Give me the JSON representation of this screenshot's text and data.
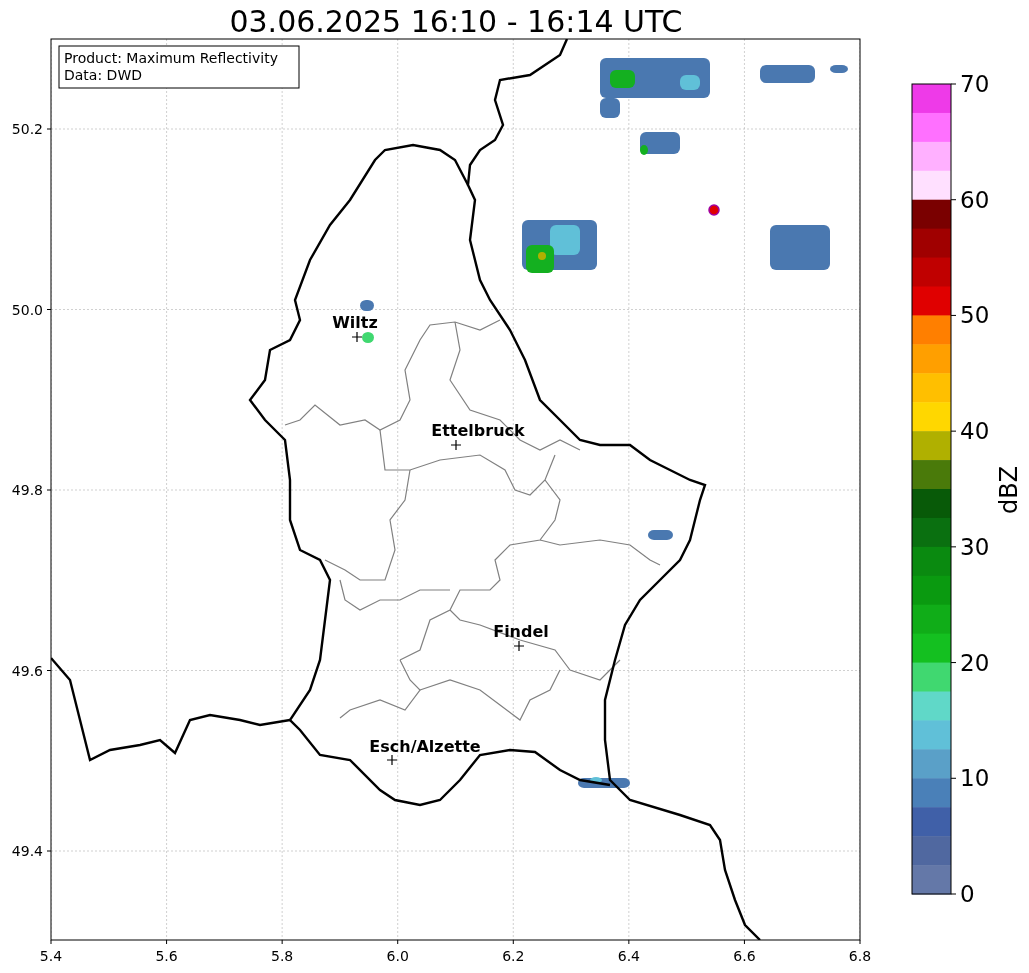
{
  "title": "03.06.2025 16:10 - 16:14 UTC",
  "legend": [
    "Product: Maximum Reflectivity",
    "Data: DWD"
  ],
  "map": {
    "x_ticks": [
      "5.4",
      "5.6",
      "5.8",
      "6.0",
      "6.2",
      "6.4",
      "6.6",
      "6.8"
    ],
    "y_ticks": [
      "50.2",
      "50.0",
      "49.8",
      "49.6",
      "49.4"
    ],
    "places": [
      {
        "name": "Wiltz"
      },
      {
        "name": "Ettelbruck"
      },
      {
        "name": "Findel"
      },
      {
        "name": "Esch/Alzette"
      }
    ]
  },
  "colorbar": {
    "label": "dBZ",
    "ticks": [
      "70",
      "60",
      "50",
      "40",
      "30",
      "20",
      "10",
      "0"
    ],
    "levels": [
      {
        "color": "#ee3ae8"
      },
      {
        "color": "#ff70ff"
      },
      {
        "color": "#ffb0ff"
      },
      {
        "color": "#ffe0ff"
      },
      {
        "color": "#7a0000"
      },
      {
        "color": "#a00000"
      },
      {
        "color": "#c00000"
      },
      {
        "color": "#e00000"
      },
      {
        "color": "#ff7f00"
      },
      {
        "color": "#ff9f00"
      },
      {
        "color": "#ffbf00"
      },
      {
        "color": "#ffd700"
      },
      {
        "color": "#b0b000"
      },
      {
        "color": "#4a7a0a"
      },
      {
        "color": "#085a08"
      },
      {
        "color": "#0a7010"
      },
      {
        "color": "#0a8a10"
      },
      {
        "color": "#0a9a10"
      },
      {
        "color": "#10ad18"
      },
      {
        "color": "#14c020"
      },
      {
        "color": "#40d870"
      },
      {
        "color": "#60d8c8"
      },
      {
        "color": "#60c0d8"
      },
      {
        "color": "#5aa0c8"
      },
      {
        "color": "#4a80b8"
      },
      {
        "color": "#4060a8"
      },
      {
        "color": "#5068a0"
      },
      {
        "color": "#6478a8"
      }
    ]
  }
}
